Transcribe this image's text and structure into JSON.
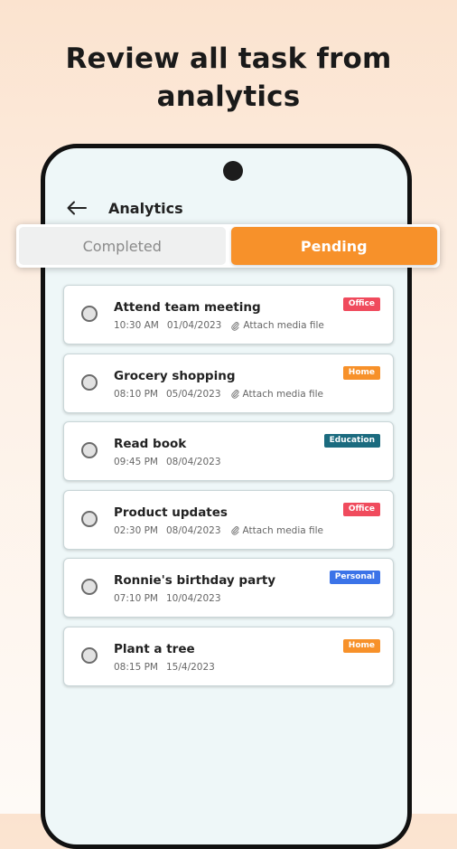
{
  "headline": {
    "line1": "Review all task from",
    "line2": "analytics"
  },
  "appbar": {
    "title": "Analytics",
    "back_icon": "arrow-left-icon"
  },
  "tabs": {
    "completed": "Completed",
    "pending": "Pending",
    "active": "pending"
  },
  "colors": {
    "accent": "#f7912a",
    "office": "#f04b5d",
    "home": "#f7912a",
    "education": "#1b6b7f",
    "personal": "#3b73e8"
  },
  "tasks": [
    {
      "title": "Attend team meeting",
      "time": "10:30 AM",
      "date": "01/04/2023",
      "attach": "Attach media file",
      "tag": "Office"
    },
    {
      "title": "Grocery shopping",
      "time": "08:10 PM",
      "date": "05/04/2023",
      "attach": "Attach media file",
      "tag": "Home"
    },
    {
      "title": "Read book",
      "time": "09:45 PM",
      "date": "08/04/2023",
      "tag": "Education"
    },
    {
      "title": "Product updates",
      "time": "02:30 PM",
      "date": "08/04/2023",
      "attach": "Attach media file",
      "tag": "Office"
    },
    {
      "title": "Ronnie's birthday party",
      "time": "07:10 PM",
      "date": "10/04/2023",
      "tag": "Personal"
    },
    {
      "title": "Plant a tree",
      "time": "08:15 PM",
      "date": "15/4/2023",
      "tag": "Home"
    }
  ]
}
